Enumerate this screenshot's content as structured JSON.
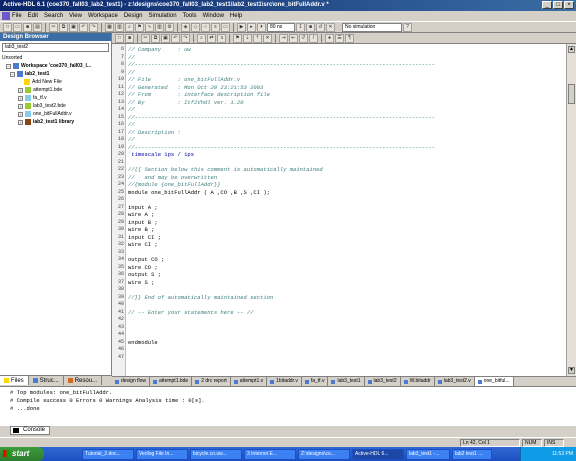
{
  "window": {
    "title": "Active-HDL 6.1  (coe370_fall03_lab2_test1) - z:\\designs\\coe370_fall03_lab2_test1\\lab2_test1\\src\\one_bitFullAddr.v *"
  },
  "menu": [
    "File",
    "Edit",
    "Search",
    "View",
    "Workspace",
    "Design",
    "Simulation",
    "Tools",
    "Window",
    "Help"
  ],
  "toolbar": {
    "sim_time": "80 ns",
    "sim_status": "No simulation"
  },
  "sidebar": {
    "title": "Design Browser",
    "selector": "lab3_test2",
    "tree": [
      {
        "label": "Unsorted",
        "bold": false,
        "level": 0
      },
      {
        "label": "Workspace 'coe370_fall03_l...",
        "bold": true,
        "level": 1
      },
      {
        "label": "lab2_test1",
        "bold": true,
        "level": 1
      },
      {
        "label": "Add New File",
        "bold": false,
        "level": 2
      },
      {
        "label": "attempt1.bde",
        "bold": false,
        "level": 2
      },
      {
        "label": "fa_tf.v",
        "bold": false,
        "level": 2
      },
      {
        "label": "lab3_test2.bde",
        "bold": false,
        "level": 2
      },
      {
        "label": "one_bitFullAddr.v",
        "bold": false,
        "level": 2
      },
      {
        "label": "lab2_test1 library",
        "bold": true,
        "level": 2
      }
    ],
    "tabs": [
      "Files",
      "Struc...",
      "Resou..."
    ]
  },
  "editor": {
    "lines": [
      {
        "n": "",
        "t": "// Company     : uw",
        "c": "cmt"
      },
      {
        "n": "",
        "t": "//",
        "c": "cmt"
      },
      {
        "n": "",
        "t": "//-------------------------------------------------------------------------------------------",
        "c": "cmt"
      },
      {
        "n": "",
        "t": "//",
        "c": "cmt"
      },
      {
        "n": "",
        "t": "// File        : one_bitFullAddr.v",
        "c": "cmt"
      },
      {
        "n": "",
        "t": "// Generated   : Mon Oct 20 23:21:53 2003",
        "c": "cmt"
      },
      {
        "n": "",
        "t": "// From        : interface description file",
        "c": "cmt"
      },
      {
        "n": "",
        "t": "// By          : Itf2Vhdl ver. 1.20",
        "c": "cmt"
      },
      {
        "n": "",
        "t": "//",
        "c": "cmt"
      },
      {
        "n": "",
        "t": "//-------------------------------------------------------------------------------------------",
        "c": "cmt"
      },
      {
        "n": "",
        "t": "//",
        "c": "cmt"
      },
      {
        "n": "",
        "t": "// Description :",
        "c": "cmt"
      },
      {
        "n": "",
        "t": "//",
        "c": "cmt"
      },
      {
        "n": "",
        "t": "//-------------------------------------------------------------------------------------------",
        "c": "cmt"
      },
      {
        "n": "",
        "t": "`timescale 1ps / 1ps",
        "c": "kw"
      },
      {
        "n": "",
        "t": "",
        "c": ""
      },
      {
        "n": "",
        "t": "//{{ Section below this comment is automatically maintained",
        "c": "cmt"
      },
      {
        "n": "",
        "t": "//   and may be overwritten",
        "c": "cmt"
      },
      {
        "n": "",
        "t": "//{module {one_bitFullAddr}}",
        "c": "cmt"
      },
      {
        "n": "",
        "t": "module one_bitFullAddr ( A ,CO ,B ,S ,CI );",
        "c": ""
      },
      {
        "n": "",
        "t": "",
        "c": ""
      },
      {
        "n": "",
        "t": "input A ;",
        "c": ""
      },
      {
        "n": "",
        "t": "wire A ;",
        "c": ""
      },
      {
        "n": "",
        "t": "input B ;",
        "c": ""
      },
      {
        "n": "",
        "t": "wire B ;",
        "c": ""
      },
      {
        "n": "",
        "t": "input CI ;",
        "c": ""
      },
      {
        "n": "",
        "t": "wire CI ;",
        "c": ""
      },
      {
        "n": "",
        "t": "",
        "c": ""
      },
      {
        "n": "",
        "t": "output CO ;",
        "c": ""
      },
      {
        "n": "",
        "t": "wire CO ;",
        "c": ""
      },
      {
        "n": "",
        "t": "output S ;",
        "c": ""
      },
      {
        "n": "",
        "t": "wire S ;",
        "c": ""
      },
      {
        "n": "",
        "t": "",
        "c": ""
      },
      {
        "n": "",
        "t": "//}} End of automatically maintained section",
        "c": "cmt"
      },
      {
        "n": "",
        "t": "",
        "c": ""
      },
      {
        "n": "",
        "t": "// -- Enter your statements here -- //",
        "c": "cmt"
      },
      {
        "n": "",
        "t": "",
        "c": ""
      },
      {
        "n": "",
        "t": "",
        "c": ""
      },
      {
        "n": "",
        "t": "",
        "c": ""
      },
      {
        "n": "",
        "t": "endmodule",
        "c": ""
      },
      {
        "n": "",
        "t": "",
        "c": ""
      },
      {
        "n": "",
        "t": "",
        "c": ""
      }
    ],
    "line_numbers": [
      "6",
      "7",
      "8",
      "9",
      "10",
      "11",
      "12",
      "13",
      "14",
      "15",
      "16",
      "17",
      "18",
      "19",
      "20",
      "21",
      "22",
      "23",
      "24",
      "25",
      "26",
      "27",
      "28",
      "29",
      "30",
      "31",
      "32",
      "33",
      "34",
      "35",
      "36",
      "37",
      "38",
      "39",
      "40",
      "41",
      "42",
      "43",
      "44",
      "45",
      "46",
      "47"
    ]
  },
  "doc_tabs": [
    {
      "label": "design flow",
      "active": false
    },
    {
      "label": "attempt1.bde",
      "active": false
    },
    {
      "label": "2 drc report",
      "active": false
    },
    {
      "label": "attempt1.v",
      "active": false
    },
    {
      "label": "1bitaddr.v",
      "active": false
    },
    {
      "label": "fa_tf.v",
      "active": false
    },
    {
      "label": "lab3_test1",
      "active": false
    },
    {
      "label": "lab3_test2",
      "active": false
    },
    {
      "label": "W.bitaddr",
      "active": false
    },
    {
      "label": "lab3_test2.v",
      "active": false
    },
    {
      "label": "one_bitful...",
      "active": true
    }
  ],
  "console": {
    "lines": [
      "# Top modules: one_bitFullAddr.",
      "# Compile success 0 Errors 0 Warnings  Analysis time : 0[s].",
      "# ...done"
    ],
    "tab_label": "Console"
  },
  "status": {
    "position": "Ln 42, Col 1",
    "modes": [
      "NUM",
      "INS"
    ]
  },
  "taskbar": {
    "start_label": "start",
    "tasks": [
      "Tutorial_2.doc...",
      "Verilog File In...",
      "bicycle.co.uw...",
      "3 Internet E...",
      "Z:\\designs\\co...",
      "Active-HDL 6...",
      "lab3_test1 -...",
      "lab2 test1 ..."
    ],
    "clock": "11:53 PM"
  }
}
